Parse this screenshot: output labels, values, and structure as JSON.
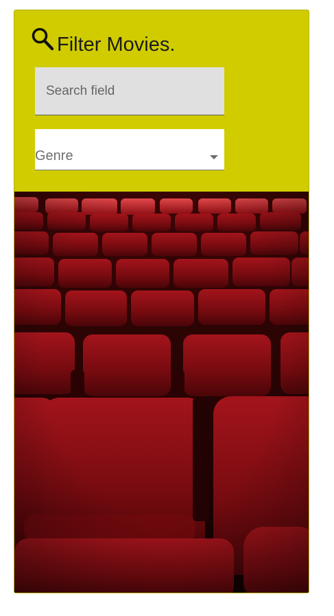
{
  "filter": {
    "title": "Filter Movies.",
    "search": {
      "placeholder": "Search field",
      "value": ""
    },
    "genre": {
      "label": "Genre"
    },
    "icon": "search-icon"
  },
  "hero": {
    "subject": "theater-seats-image"
  },
  "colors": {
    "panel": "#d0cc00",
    "seat": "#8a0d12",
    "seat_dark": "#3a0406"
  }
}
